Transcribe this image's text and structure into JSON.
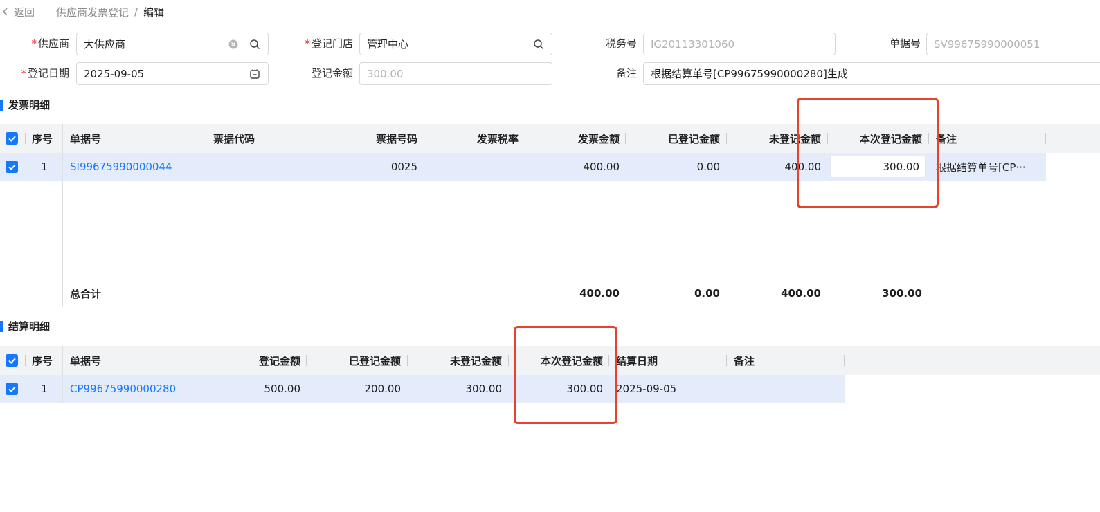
{
  "breadcrumb": {
    "back": "返回",
    "parent": "供应商发票登记",
    "slash": "/",
    "current": "编辑"
  },
  "form": {
    "supplier": {
      "label": "供应商",
      "value": "大供应商"
    },
    "store": {
      "label": "登记门店",
      "value": "管理中心"
    },
    "tax_no": {
      "label": "税务号",
      "value": "IG20113301060"
    },
    "doc_no": {
      "label": "单据号",
      "value": "SV99675990000051"
    },
    "reg_date": {
      "label": "登记日期",
      "value": "2025-09-05"
    },
    "reg_amount": {
      "label": "登记金额",
      "value": "300.00"
    },
    "remark": {
      "label": "备注",
      "value": "根据结算单号[CP99675990000280]生成"
    },
    "required_mark": "*"
  },
  "invoice_section": {
    "title": "发票明细",
    "headers": {
      "seq": "序号",
      "doc_no": "单据号",
      "code": "票据代码",
      "number": "票据号码",
      "tax_rate": "发票税率",
      "amount": "发票金额",
      "registered": "已登记金额",
      "unregistered": "未登记金额",
      "current": "本次登记金额",
      "remark": "备注"
    },
    "rows": [
      {
        "seq": "1",
        "doc_no": "SI99675990000044",
        "code": "",
        "number": "0025",
        "tax_rate": "",
        "amount": "400.00",
        "registered": "0.00",
        "unregistered": "400.00",
        "current": "300.00",
        "remark": "根据结算单号[CP···"
      }
    ],
    "totals": {
      "label": "总合计",
      "amount": "400.00",
      "registered": "0.00",
      "unregistered": "400.00",
      "current": "300.00"
    }
  },
  "settlement_section": {
    "title": "结算明细",
    "headers": {
      "seq": "序号",
      "doc_no": "单据号",
      "reg_amount": "登记金额",
      "registered": "已登记金额",
      "unregistered": "未登记金额",
      "current": "本次登记金额",
      "date": "结算日期",
      "remark": "备注"
    },
    "rows": [
      {
        "seq": "1",
        "doc_no": "CP99675990000280",
        "reg_amount": "500.00",
        "registered": "200.00",
        "unregistered": "300.00",
        "current": "300.00",
        "date": "2025-09-05",
        "remark": ""
      }
    ]
  },
  "colors": {
    "accent": "#1677ff",
    "highlight": "#e8412c",
    "row_selected": "#e4ecfb",
    "header_bg": "#f2f3f5"
  }
}
